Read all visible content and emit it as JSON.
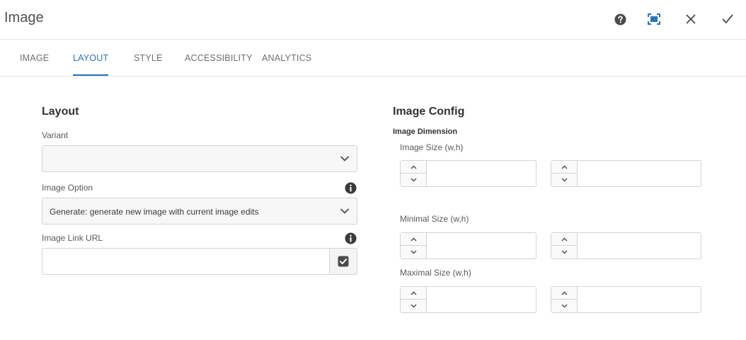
{
  "dialog": {
    "title": "Image"
  },
  "tabs": [
    {
      "label": "IMAGE",
      "active": false
    },
    {
      "label": "LAYOUT",
      "active": true
    },
    {
      "label": "STYLE",
      "active": false
    },
    {
      "label": "ACCESSIBILITY",
      "active": false
    },
    {
      "label": "ANALYTICS",
      "active": false
    }
  ],
  "layout": {
    "heading": "Layout",
    "variant": {
      "label": "Variant",
      "value": ""
    },
    "image_option": {
      "label": "Image Option",
      "value": "Generate: generate new image with current image edits"
    },
    "image_link": {
      "label": "Image Link URL",
      "value": ""
    }
  },
  "image_config": {
    "heading": "Image Config",
    "dimension_heading": "Image Dimension",
    "image_size": {
      "label": "Image Size (w,h)",
      "w": "",
      "h": ""
    },
    "minimal_size": {
      "label": "Minimal Size (w,h)",
      "w": "",
      "h": ""
    },
    "maximal_size": {
      "label": "Maximal Size (w,h)",
      "w": "",
      "h": ""
    }
  },
  "icons": {
    "help": "help-icon",
    "fullscreen": "fullscreen-icon",
    "close": "close-icon",
    "done": "checkmark-icon",
    "info": "info-icon",
    "chevron": "chevron-down-icon",
    "checkbox": "checkbox-checked-icon"
  },
  "colors": {
    "accent": "#2d73b9",
    "icon": "#4b4b4b"
  }
}
